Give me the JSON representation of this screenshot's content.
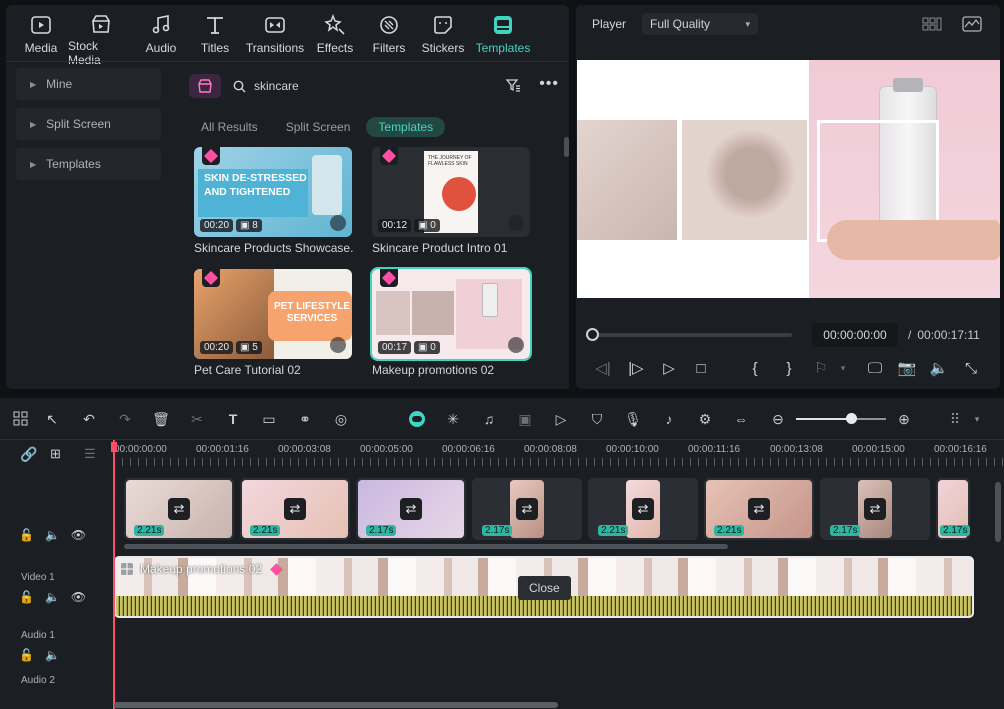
{
  "colors": {
    "accent": "#3fd6c0",
    "playhead": "#ff4c6a",
    "duration_badge": "#2fb6a2",
    "premium": "#ff4fa3"
  },
  "toolbar": {
    "tabs": [
      {
        "label": "Media",
        "icon": "media-icon"
      },
      {
        "label": "Stock Media",
        "icon": "stock-media-icon"
      },
      {
        "label": "Audio",
        "icon": "audio-icon"
      },
      {
        "label": "Titles",
        "icon": "titles-icon"
      },
      {
        "label": "Transitions",
        "icon": "transitions-icon"
      },
      {
        "label": "Effects",
        "icon": "effects-icon"
      },
      {
        "label": "Filters",
        "icon": "filters-icon"
      },
      {
        "label": "Stickers",
        "icon": "stickers-icon"
      },
      {
        "label": "Templates",
        "icon": "templates-icon",
        "active": true
      }
    ]
  },
  "sidebar": {
    "items": [
      {
        "label": "Mine"
      },
      {
        "label": "Split Screen"
      },
      {
        "label": "Templates"
      }
    ]
  },
  "search": {
    "query": "skincare"
  },
  "result_tabs": [
    {
      "label": "All Results"
    },
    {
      "label": "Split Screen"
    },
    {
      "label": "Templates",
      "active": true
    }
  ],
  "templates": [
    {
      "title": "Skincare Products Showcase...",
      "duration": "00:20",
      "clips": "8",
      "art_text": "SKIN DE-STRESSED AND TIGHTENED"
    },
    {
      "title": "Skincare Product Intro 01",
      "duration": "00:12",
      "clips": "0",
      "art_text": "THE JOURNEY OF FLAWLESS SKIN"
    },
    {
      "title": "Pet Care Tutorial 02",
      "duration": "00:20",
      "clips": "5",
      "art_text": "PET LIFESTYLE SERVICES"
    },
    {
      "title": "Makeup promotions 02",
      "duration": "00:17",
      "clips": "0",
      "selected": true
    }
  ],
  "player": {
    "label": "Player",
    "quality": "Full Quality",
    "current_time": "00:00:00:00",
    "separator": "/",
    "total_time": "00:00:17:11",
    "progress": 0
  },
  "timeline": {
    "ruler": [
      "00:00:00:00",
      "00:00:01:16",
      "00:00:03:08",
      "00:00:05:00",
      "00:00:06:16",
      "00:00:08:08",
      "00:00:10:00",
      "00:00:11:16",
      "00:00:13:08",
      "00:00:15:00",
      "00:00:16:16"
    ],
    "zoom": 0.6,
    "clips": [
      {
        "duration": "2.21s"
      },
      {
        "duration": "2.21s"
      },
      {
        "duration": "2.17s"
      },
      {
        "duration": "2.17s"
      },
      {
        "duration": "2.21s"
      },
      {
        "duration": "2.21s"
      },
      {
        "duration": "2.17s"
      },
      {
        "duration": "2.17s"
      }
    ],
    "video_clip_title": "Makeup promotions 02",
    "tracks": [
      {
        "label": "Video 1"
      },
      {
        "label": "Audio 1"
      },
      {
        "label": "Audio 2"
      }
    ],
    "tooltip": "Close"
  }
}
